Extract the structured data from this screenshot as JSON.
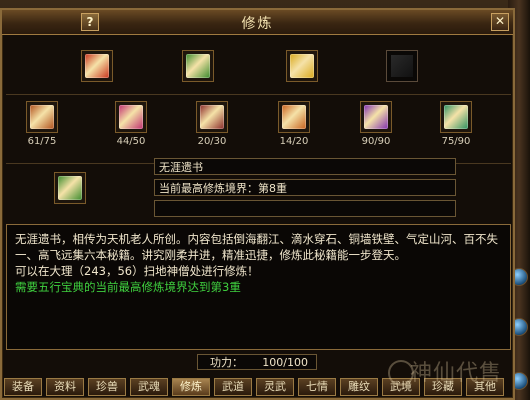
{
  "window": {
    "title": "修炼",
    "help_label": "?",
    "close_label": "✕"
  },
  "top_books": [
    {
      "icon": "red-book-icon",
      "color": "#c8341c"
    },
    {
      "icon": "green-book-icon",
      "color": "#3a8a2c"
    },
    {
      "icon": "gold-book-icon",
      "color": "#d8a81c"
    },
    {
      "icon": "empty-slot-icon",
      "color": "#1a1a1a"
    }
  ],
  "skills": [
    {
      "icon": "brown-scroll-icon",
      "color": "#b0501c",
      "count": "61/75"
    },
    {
      "icon": "pink-scroll-icon",
      "color": "#c03070",
      "count": "44/50"
    },
    {
      "icon": "maroon-scroll-icon",
      "color": "#8a2a2a",
      "count": "20/30"
    },
    {
      "icon": "orange-scroll-icon",
      "color": "#c8601c",
      "count": "14/20"
    },
    {
      "icon": "purple-scroll-icon",
      "color": "#8030b0",
      "count": "90/90"
    },
    {
      "icon": "teal-scroll-icon",
      "color": "#2c9060",
      "count": "75/90"
    }
  ],
  "selected": {
    "icon": "green-book-icon",
    "color": "#3a8a2c",
    "name": "无涯遗书",
    "realm": "当前最高修炼境界：第8重",
    "extra": ""
  },
  "description": {
    "line1": "无涯遗书，相传为天机老人所创。内容包括倒海翻江、滴水穿石、铜墙铁壁、气定山河、百不失一、高飞远集六本秘籍。讲究刚柔并进，精准迅捷，修炼此秘籍能一步登天。",
    "line2": "可以在大理（243，56）扫地神僧处进行修炼！",
    "line3": "需要五行宝典的当前最高修炼境界达到第3重"
  },
  "power": {
    "label": "功力：",
    "value": "100/100"
  },
  "tabs": [
    "装备",
    "资料",
    "珍兽",
    "武魂",
    "修炼",
    "武道",
    "灵武",
    "七情",
    "雕纹",
    "武境",
    "珍藏",
    "其他"
  ],
  "active_tab": "修炼",
  "watermark": "神仙代售"
}
